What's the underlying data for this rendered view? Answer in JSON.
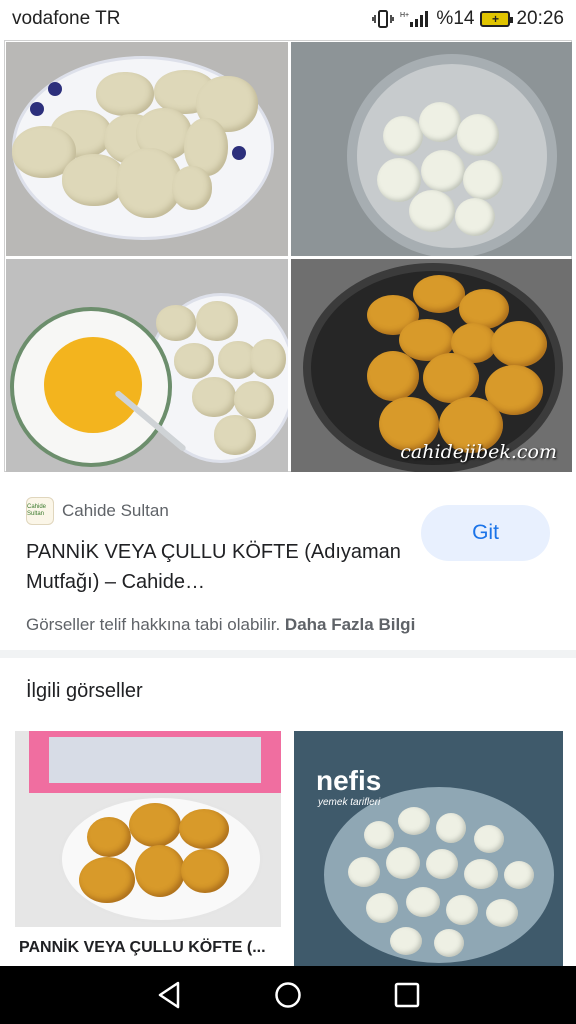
{
  "status_bar": {
    "carrier": "vodafone TR",
    "battery": "%14",
    "time": "20:26"
  },
  "main_image": {
    "watermark": "cahidejibek.com"
  },
  "result": {
    "source_logo_text": "Cahide Sultan",
    "source_name": "Cahide Sultan",
    "visit_label": "Git",
    "title": "PANNİK VEYA ÇULLU KÖFTE (Adıyaman Mutfağı) – Cahide…",
    "copyright_text": "Görseller telif hakkına tabi olabilir.",
    "more_info_label": "Daha Fazla Bilgi"
  },
  "related": {
    "heading": "İlgili görseller",
    "items": [
      {
        "caption": "PANNİK VEYA ÇULLU KÖFTE (..."
      },
      {
        "brand": "nefis",
        "brand_sub": "yemek tarifleri"
      }
    ]
  },
  "icons": [
    "vibrate-icon",
    "signal-icon",
    "battery-icon",
    "back-icon",
    "home-icon",
    "recents-icon"
  ]
}
